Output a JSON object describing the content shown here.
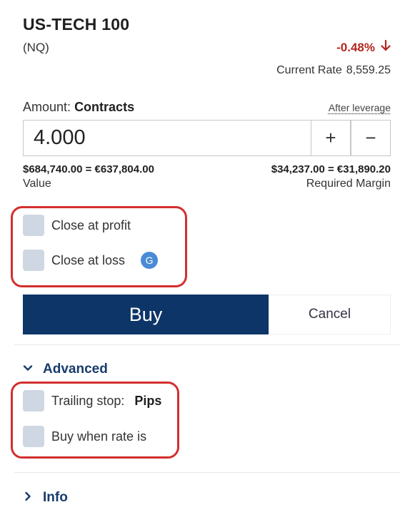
{
  "instrument": {
    "name": "US-TECH 100",
    "ticker": "(NQ)",
    "change": "-0.48%",
    "current_rate_label": "Current Rate",
    "current_rate_value": "8,559.25"
  },
  "amount": {
    "label": "Amount:",
    "unit": "Contracts",
    "after_leverage_link": "After leverage",
    "value": "4.000",
    "plus_label": "+",
    "minus_label": "−"
  },
  "summary": {
    "value_amount": "$684,740.00 = €637,804.00",
    "value_label": "Value",
    "margin_amount": "$34,237.00 = €31,890.20",
    "margin_label": "Required Margin"
  },
  "options": {
    "close_at_profit": "Close at profit",
    "close_at_loss": "Close at loss",
    "guaranteed_badge": "G"
  },
  "actions": {
    "buy_label": "Buy",
    "cancel_label": "Cancel"
  },
  "advanced": {
    "title": "Advanced",
    "trailing_stop_label": "Trailing stop:",
    "trailing_stop_unit": "Pips",
    "buy_when_rate": "Buy when rate is"
  },
  "info": {
    "title": "Info"
  },
  "colors": {
    "accent": "#0d3568",
    "negative": "#b3261e",
    "highlight": "#d32f2f",
    "checkbox": "#cfd7e3",
    "badge": "#4a8bd6"
  }
}
